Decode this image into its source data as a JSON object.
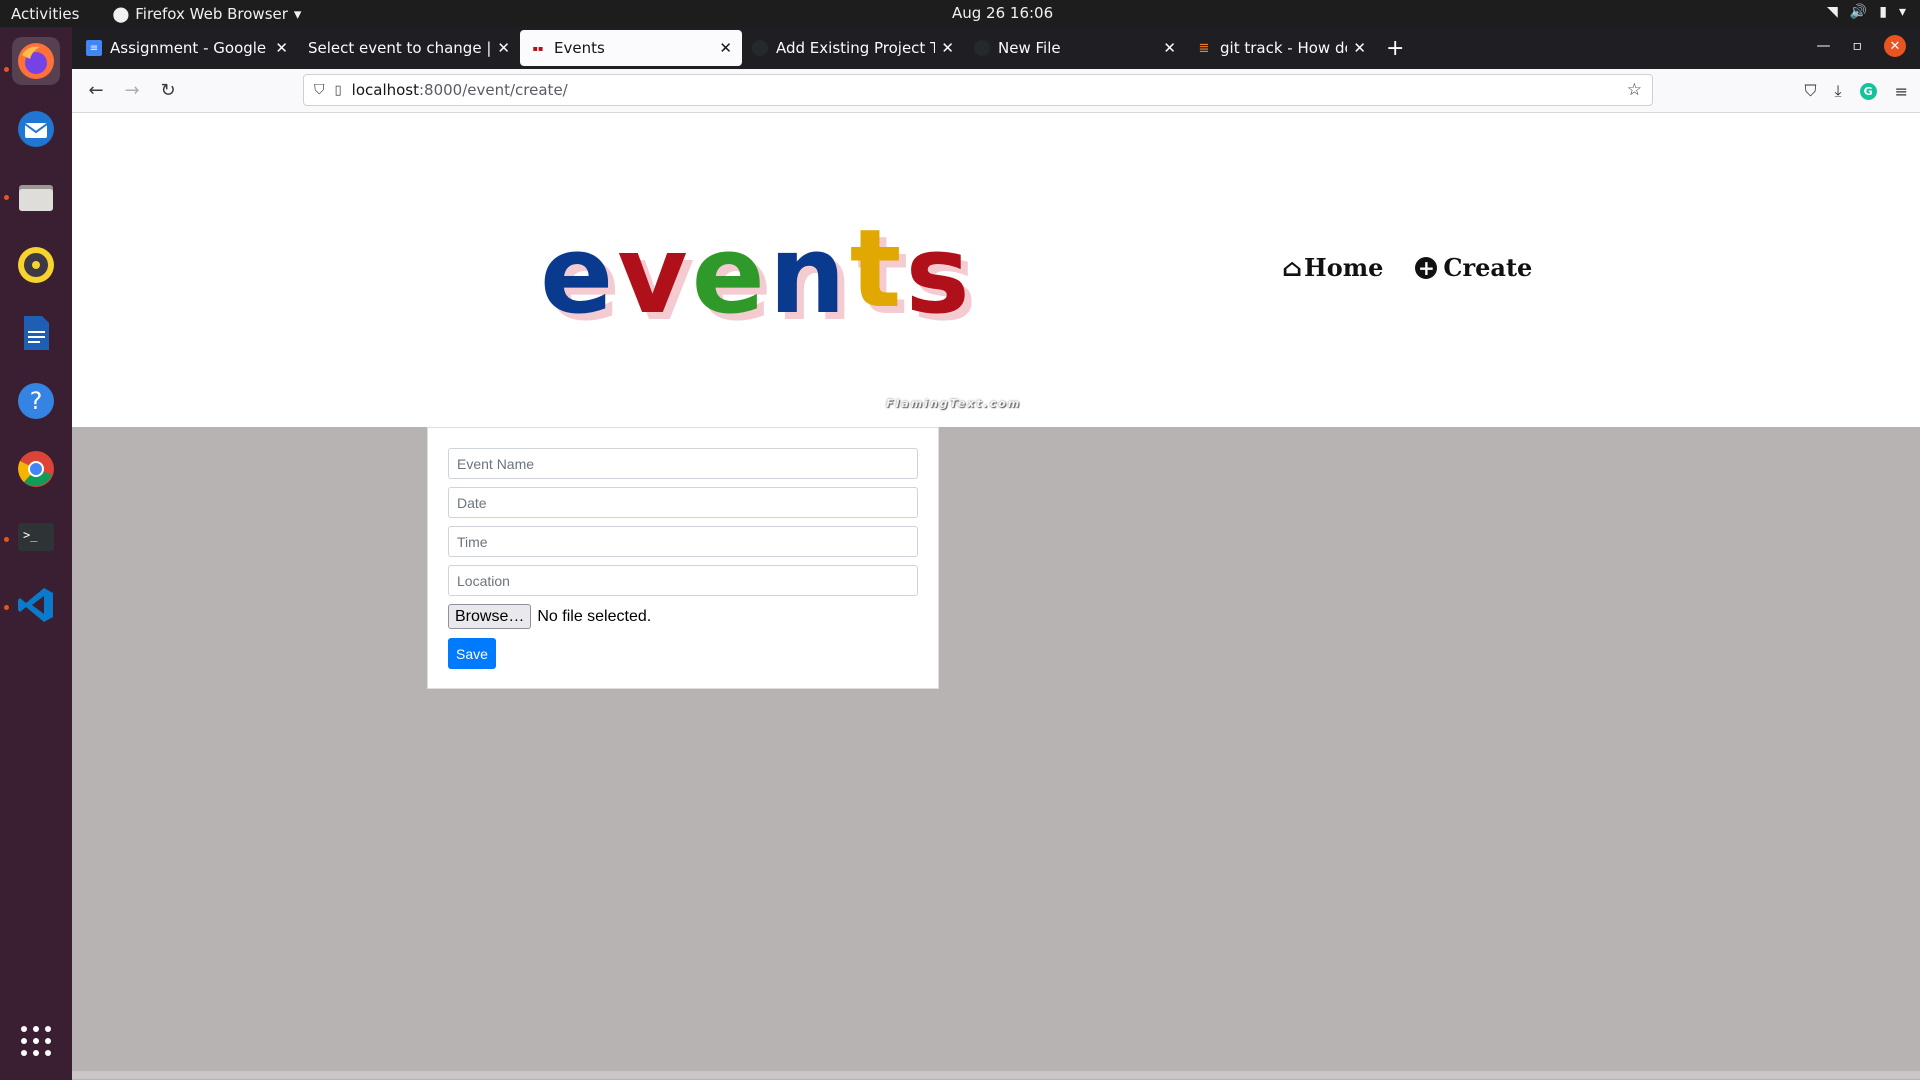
{
  "system": {
    "activities": "Activities",
    "app_menu": "Firefox Web Browser",
    "clock": "Aug 26  16:06"
  },
  "dock": {
    "items": [
      "firefox-icon",
      "thunderbird-icon",
      "files-icon",
      "rhythmbox-icon",
      "writer-icon",
      "help-icon",
      "chrome-icon",
      "terminal-icon",
      "vscode-icon"
    ],
    "apps_grid": "show-apps-icon"
  },
  "tabs": [
    {
      "label": "Assignment - Google Doc",
      "icon": "google-docs-icon"
    },
    {
      "label": "Select event to change | Djan",
      "icon": "django-icon"
    },
    {
      "label": "Events",
      "icon": "events-favicon",
      "active": true
    },
    {
      "label": "Add Existing Project To G",
      "icon": "github-icon"
    },
    {
      "label": "New File",
      "icon": "github-icon"
    },
    {
      "label": "git track - How do I remo",
      "icon": "stackoverflow-icon"
    }
  ],
  "address": {
    "host": "localhost",
    "path": ":8000/event/create/"
  },
  "page": {
    "logo_letters": [
      "e",
      "v",
      "e",
      "n",
      "t",
      "s"
    ],
    "logo_credit": "FlamingText.com",
    "nav": {
      "home": "Home",
      "create": "Create"
    },
    "form": {
      "event_name_placeholder": "Event Name",
      "date_placeholder": "Date",
      "time_placeholder": "Time",
      "location_placeholder": "Location",
      "browse_label": "Browse…",
      "file_status": "No file selected.",
      "save_label": "Save"
    }
  },
  "colors": {
    "accent": "#007bff",
    "page_bg": "#b7b3b2",
    "ubuntu_orange": "#e95420"
  }
}
